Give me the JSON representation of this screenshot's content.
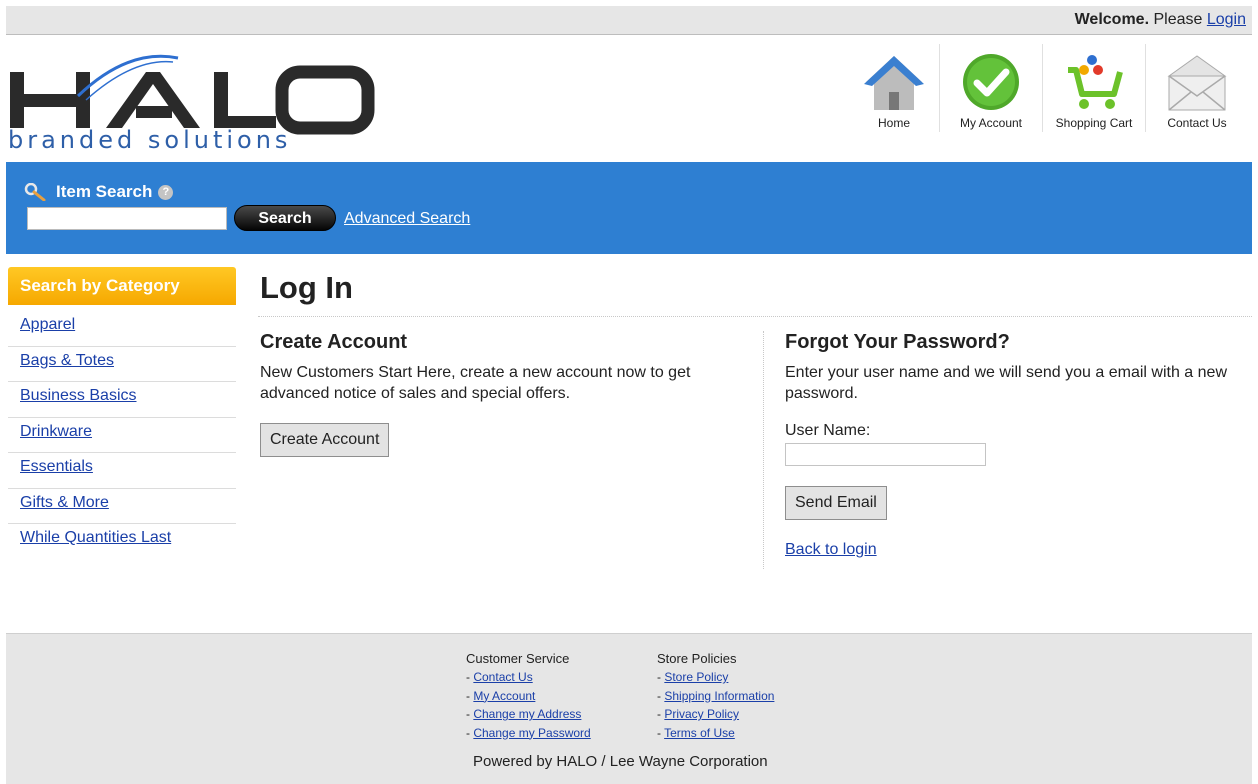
{
  "topbar": {
    "welcome": "Welcome.",
    "please": "Please",
    "login": "Login"
  },
  "logo": {
    "main": "HALO",
    "tagline": "branded solutions"
  },
  "nav": [
    {
      "label": "Home",
      "icon": "house-icon"
    },
    {
      "label": "My Account",
      "icon": "checkmark-icon"
    },
    {
      "label": "Shopping Cart",
      "icon": "cart-icon"
    },
    {
      "label": "Contact Us",
      "icon": "envelope-icon"
    }
  ],
  "search": {
    "label": "Item Search",
    "help": "?",
    "value": "",
    "button": "Search",
    "advanced": "Advanced Search"
  },
  "sidebar": {
    "title": "Search by Category",
    "items": [
      "Apparel",
      "Bags & Totes",
      "Business Basics",
      "Drinkware",
      "Essentials",
      "Gifts & More",
      "While Quantities Last"
    ]
  },
  "main": {
    "title": "Log In",
    "create": {
      "heading": "Create Account",
      "text": "New Customers Start Here, create a new account now to get advanced notice of sales and special offers.",
      "button": "Create Account"
    },
    "forgot": {
      "heading": "Forgot Your Password?",
      "text": "Enter your user name and we will send you a email with a new password.",
      "username_label": "User Name:",
      "username_value": "",
      "button": "Send Email",
      "back": "Back to login"
    }
  },
  "footer": {
    "customer_service": {
      "heading": "Customer Service",
      "links": [
        "Contact Us",
        "My Account",
        "Change my Address",
        "Change my Password"
      ]
    },
    "store_policies": {
      "heading": "Store Policies",
      "links": [
        "Store Policy",
        "Shipping Information",
        "Privacy Policy",
        "Terms of Use"
      ]
    },
    "powered": "Powered by HALO / Lee Wayne Corporation"
  },
  "colors": {
    "band_blue": "#2e7fd2",
    "sidebar_orange": "#f6a800",
    "link_blue": "#1a3fa8"
  }
}
